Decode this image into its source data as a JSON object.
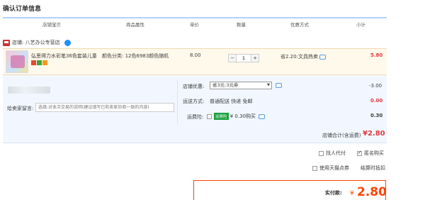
{
  "title": "确认订单信息",
  "columns": [
    "店铺宝贝",
    "商品属性",
    "单价",
    "数量",
    "优惠方式",
    "小计"
  ],
  "shop": {
    "label": "店铺: 八艺办公专营店"
  },
  "item": {
    "name": "弘思得力水彩笔36色套装儿童...",
    "attr": "颜色分类: 12色6983颜色随机",
    "price": "8.00",
    "qty": "1",
    "qty_minus": "−",
    "qty_plus": "+",
    "discount": "省2.20:文具热卖",
    "subtotal": "5.80"
  },
  "shop_discount": {
    "label": "店铺优惠:",
    "option": "省3元:3元券",
    "value": "-3.00"
  },
  "shipping": {
    "label": "运送方式:",
    "value_text": "普通配送 快递 免邮",
    "value": "0.00"
  },
  "insurance": {
    "label": "运费险:",
    "tag": "运费险",
    "text": "¥ 0.30购买",
    "value": "0.30"
  },
  "message": {
    "label": "给卖家留言:",
    "placeholder": "选填:对本次交易的说明(建议填写已和卖家协商一致的内容)"
  },
  "shop_total": {
    "label": "店铺合计(含运费)",
    "value": "¥2.80"
  },
  "options": {
    "proxy": "找人代付",
    "anonymous": "匿名购买",
    "coupon": "使用天猫点券",
    "coupon_note": "结算时抵扣"
  },
  "pay": {
    "label": "实付款:",
    "currency": "¥",
    "value": "2.80"
  }
}
